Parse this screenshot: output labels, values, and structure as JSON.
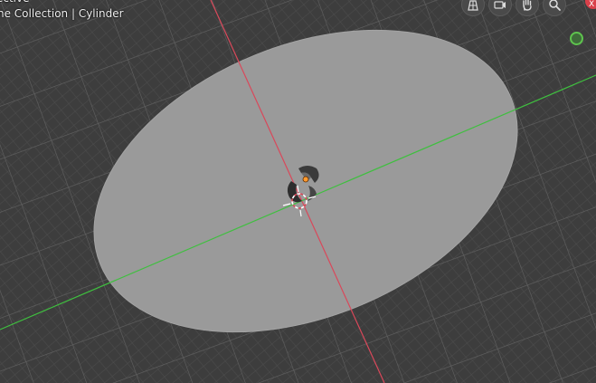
{
  "viewport": {
    "mode_label": "ective",
    "collection_label": "ne Collection | Cylinder",
    "background_color": "#3d3d3d",
    "grid_color": "#555555",
    "axis_x_color": "#d9485a",
    "axis_y_color": "#3fbf3f",
    "plane_color": "#9a9a9a"
  },
  "nav_buttons": [
    {
      "name": "perspective-toggle-icon"
    },
    {
      "name": "camera-view-icon"
    },
    {
      "name": "hand-pan-icon"
    },
    {
      "name": "zoom-magnifier-icon"
    }
  ],
  "close_button": {
    "label": "X"
  },
  "scene_objects": {
    "plane": "Plane",
    "active_object": "Cylinder"
  }
}
